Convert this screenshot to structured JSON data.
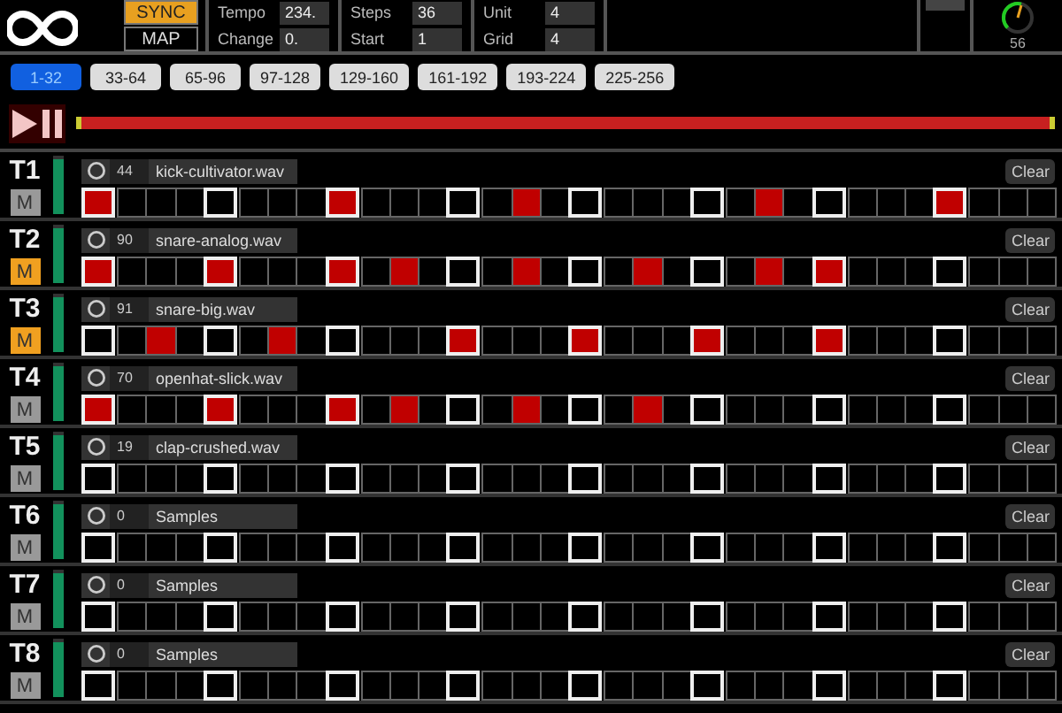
{
  "header": {
    "sync_button": {
      "label": "SYNC",
      "on": true
    },
    "map_button": {
      "label": "MAP"
    },
    "field_columns": [
      [
        {
          "label": "Tempo",
          "value": "234."
        },
        {
          "label": "Change",
          "value": "0."
        }
      ],
      [
        {
          "label": "Steps",
          "value": "36"
        },
        {
          "label": "Start",
          "value": "1"
        }
      ],
      [
        {
          "label": "Unit",
          "value": "4"
        },
        {
          "label": "Grid",
          "value": "4"
        }
      ]
    ],
    "knob": {
      "reading": "56"
    }
  },
  "page_tabs": [
    {
      "label": "1-32",
      "selected": true
    },
    {
      "label": "33-64",
      "selected": false
    },
    {
      "label": "65-96",
      "selected": false
    },
    {
      "label": "97-128",
      "selected": false
    },
    {
      "label": "129-160",
      "selected": false
    },
    {
      "label": "161-192",
      "selected": false
    },
    {
      "label": "193-224",
      "selected": false
    },
    {
      "label": "225-256",
      "selected": false
    }
  ],
  "tracks": [
    {
      "name": "T1",
      "mute": "M",
      "muted": false,
      "level": 0.95,
      "number": "44",
      "sample": "kick-cultivator.wav",
      "clear": "Clear",
      "steps": [
        true,
        false,
        false,
        false,
        false,
        false,
        false,
        false,
        true,
        false,
        false,
        false,
        false,
        false,
        true,
        false,
        false,
        false,
        false,
        false,
        false,
        false,
        true,
        false,
        false,
        false,
        false,
        false,
        true,
        false,
        false,
        false
      ]
    },
    {
      "name": "T2",
      "mute": "M",
      "muted": true,
      "level": 0.95,
      "number": "90",
      "sample": "snare-analog.wav",
      "clear": "Clear",
      "steps": [
        true,
        false,
        false,
        false,
        true,
        false,
        false,
        false,
        true,
        false,
        true,
        false,
        false,
        false,
        true,
        false,
        false,
        false,
        true,
        false,
        false,
        false,
        true,
        false,
        true,
        false,
        false,
        false,
        false,
        false,
        false,
        false
      ]
    },
    {
      "name": "T3",
      "mute": "M",
      "muted": true,
      "level": 0.95,
      "number": "91",
      "sample": "snare-big.wav",
      "clear": "Clear",
      "steps": [
        false,
        false,
        true,
        false,
        false,
        false,
        true,
        false,
        false,
        false,
        false,
        false,
        true,
        false,
        false,
        false,
        true,
        false,
        false,
        false,
        true,
        false,
        false,
        false,
        true,
        false,
        false,
        false,
        false,
        false,
        false,
        false
      ]
    },
    {
      "name": "T4",
      "mute": "M",
      "muted": false,
      "level": 0.95,
      "number": "70",
      "sample": "openhat-slick.wav",
      "clear": "Clear",
      "steps": [
        true,
        false,
        false,
        false,
        true,
        false,
        false,
        false,
        true,
        false,
        true,
        false,
        false,
        false,
        true,
        false,
        false,
        false,
        true,
        false,
        false,
        false,
        false,
        false,
        false,
        false,
        false,
        false,
        false,
        false,
        false,
        false
      ]
    },
    {
      "name": "T5",
      "mute": "M",
      "muted": false,
      "level": 0.95,
      "number": "19",
      "sample": "clap-crushed.wav",
      "clear": "Clear",
      "steps": [
        false,
        false,
        false,
        false,
        false,
        false,
        false,
        false,
        false,
        false,
        false,
        false,
        false,
        false,
        false,
        false,
        false,
        false,
        false,
        false,
        false,
        false,
        false,
        false,
        false,
        false,
        false,
        false,
        false,
        false,
        false,
        false
      ]
    },
    {
      "name": "T6",
      "mute": "M",
      "muted": false,
      "level": 0.95,
      "number": "0",
      "sample": "Samples",
      "clear": "Clear",
      "steps": [
        false,
        false,
        false,
        false,
        false,
        false,
        false,
        false,
        false,
        false,
        false,
        false,
        false,
        false,
        false,
        false,
        false,
        false,
        false,
        false,
        false,
        false,
        false,
        false,
        false,
        false,
        false,
        false,
        false,
        false,
        false,
        false
      ]
    },
    {
      "name": "T7",
      "mute": "M",
      "muted": false,
      "level": 0.95,
      "number": "0",
      "sample": "Samples",
      "clear": "Clear",
      "steps": [
        false,
        false,
        false,
        false,
        false,
        false,
        false,
        false,
        false,
        false,
        false,
        false,
        false,
        false,
        false,
        false,
        false,
        false,
        false,
        false,
        false,
        false,
        false,
        false,
        false,
        false,
        false,
        false,
        false,
        false,
        false,
        false
      ]
    },
    {
      "name": "T8",
      "mute": "M",
      "muted": false,
      "level": 0.95,
      "number": "0",
      "sample": "Samples",
      "clear": "Clear",
      "steps": [
        false,
        false,
        false,
        false,
        false,
        false,
        false,
        false,
        false,
        false,
        false,
        false,
        false,
        false,
        false,
        false,
        false,
        false,
        false,
        false,
        false,
        false,
        false,
        false,
        false,
        false,
        false,
        false,
        false,
        false,
        false,
        false
      ]
    }
  ]
}
